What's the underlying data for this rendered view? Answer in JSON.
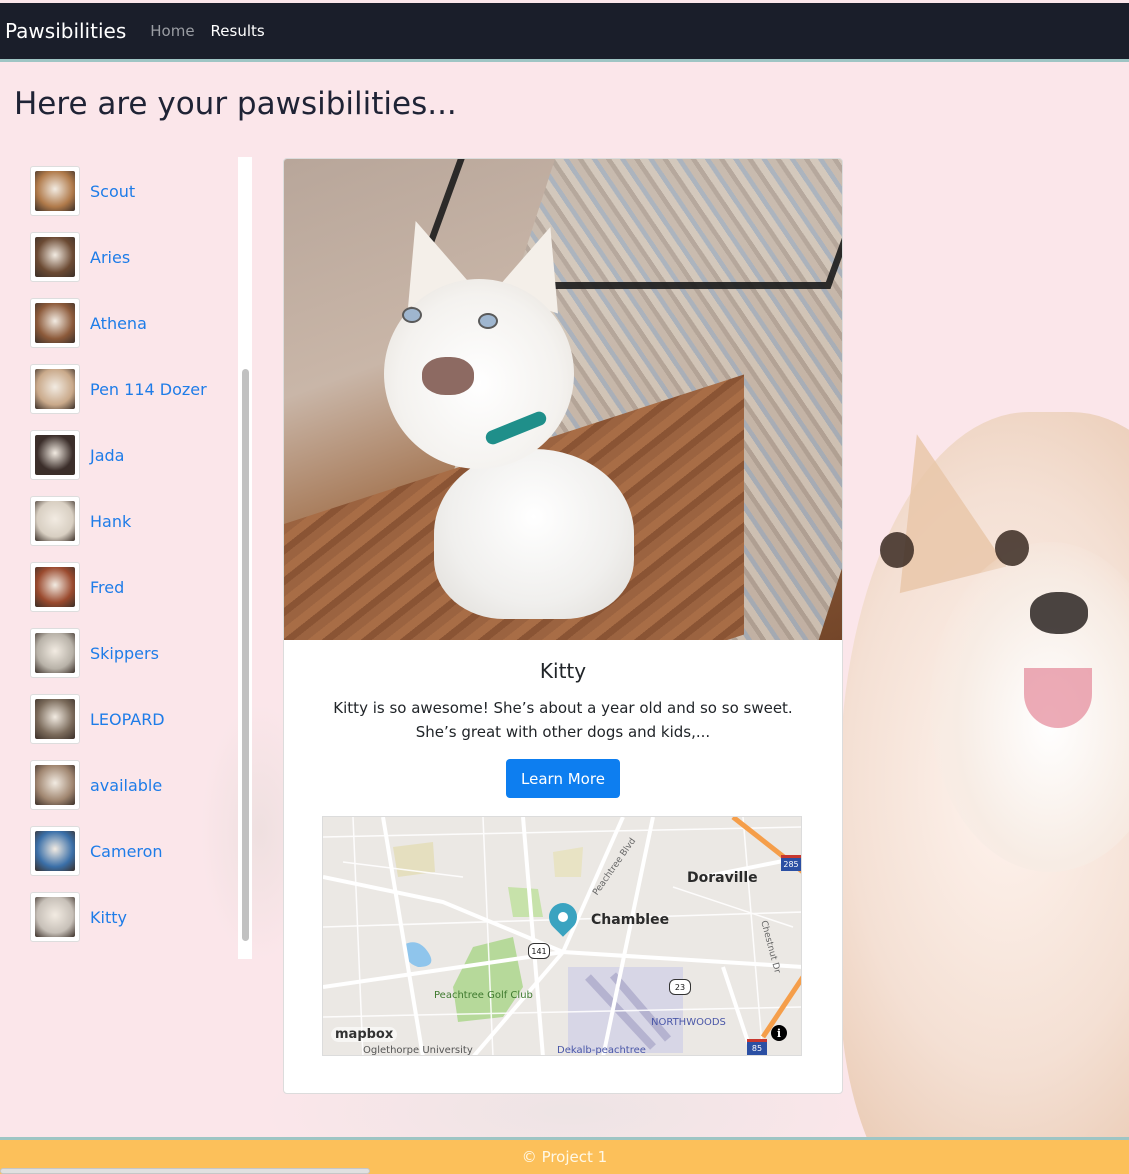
{
  "navbar": {
    "brand": "Pawsibilities",
    "links": [
      {
        "label": "Home",
        "active": false
      },
      {
        "label": "Results",
        "active": true
      }
    ]
  },
  "page": {
    "heading": "Here are your pawsibilities..."
  },
  "sidebar": {
    "items": [
      {
        "name": "Scout",
        "thumb_color": "#b07a4a"
      },
      {
        "name": "Aries",
        "thumb_color": "#6b4a33"
      },
      {
        "name": "Athena",
        "thumb_color": "#8c5a3a"
      },
      {
        "name": "Pen 114 Dozer",
        "thumb_color": "#c9a98a"
      },
      {
        "name": "Jada",
        "thumb_color": "#3b2e2a"
      },
      {
        "name": "Hank",
        "thumb_color": "#d8cfc2"
      },
      {
        "name": "Fred",
        "thumb_color": "#9a4a2e"
      },
      {
        "name": "Skippers",
        "thumb_color": "#b8b2a8"
      },
      {
        "name": "LEOPARD",
        "thumb_color": "#7a6a5a"
      },
      {
        "name": "available",
        "thumb_color": "#a08670"
      },
      {
        "name": "Cameron",
        "thumb_color": "#3a6fa8"
      },
      {
        "name": "Kitty",
        "thumb_color": "#c7c0b8"
      }
    ]
  },
  "card": {
    "title": "Kitty",
    "description": "Kitty is so awesome! She’s about a year old and so so sweet. She’s great with other dogs and kids,...",
    "button_label": "Learn More",
    "accent": "#0d7ef0"
  },
  "map": {
    "labels": {
      "doraville": "Doraville",
      "chamblee": "Chamblee",
      "peachtree_blvd": "Peachtree Blvd",
      "chestnut_dr": "Chestnut Dr",
      "golf_club": "Peachtree Golf Club",
      "northwoods": "NORTHWOODS",
      "oglethorpe": "Oglethorpe University",
      "dekalb": "Dekalb-peachtree"
    },
    "shields": {
      "route_141": "141",
      "route_23": "23",
      "interstate_285": "285",
      "interstate_85": "85"
    },
    "attribution_logo": "mapbox",
    "info_icon": "i"
  },
  "footer": {
    "text": "© Project 1",
    "color": "#fcc05a"
  }
}
